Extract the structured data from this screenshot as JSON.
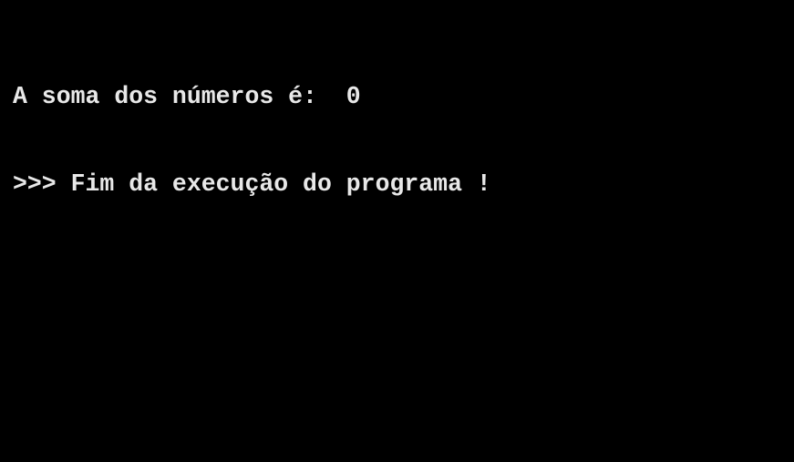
{
  "terminal": {
    "background": "#000000",
    "foreground": "#e8e8e8",
    "lines": [
      "A soma dos números é:  0",
      ">>> Fim da execução do programa !"
    ]
  }
}
